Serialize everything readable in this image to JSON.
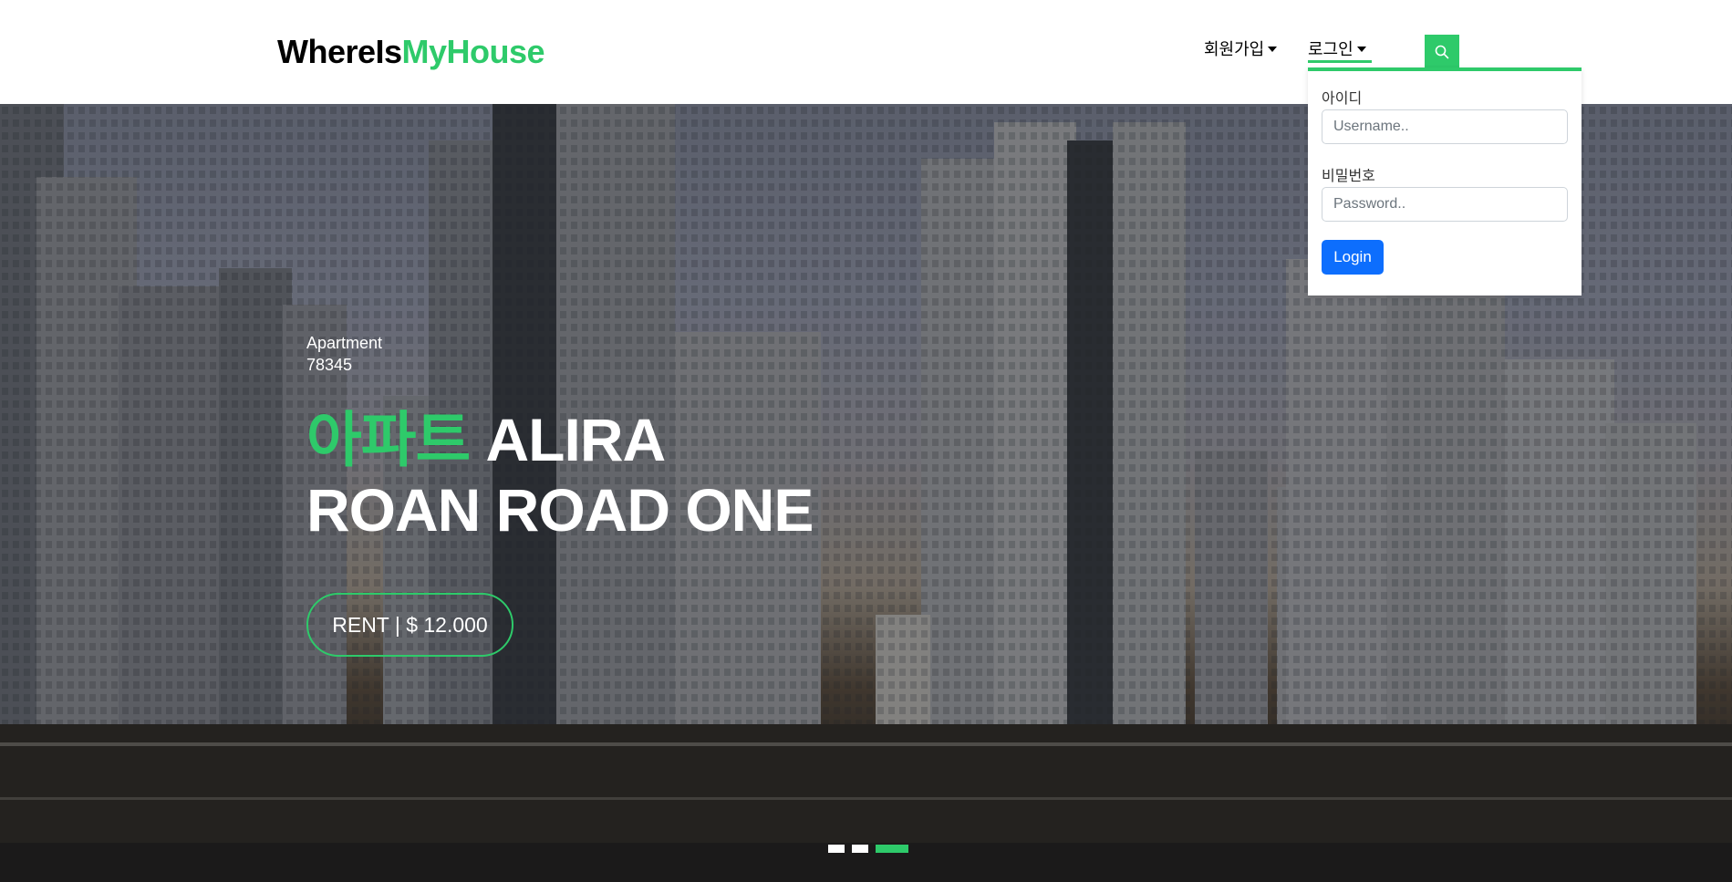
{
  "brand": {
    "name_part1": "WhereIs",
    "name_part2": "MyHouse",
    "accent_color": "#2eca6a"
  },
  "nav": {
    "signup_label": "회원가입",
    "login_label": "로그인",
    "search_icon": "search-icon"
  },
  "login_dropdown": {
    "id_label": "아이디",
    "id_placeholder": "Username..",
    "password_label": "비밀번호",
    "password_placeholder": "Password..",
    "submit_label": "Login",
    "button_color": "#0d6efd"
  },
  "hero": {
    "type_label": "Apartment",
    "code": "78345",
    "title_accent": "아파트",
    "title_line1": "ALIRA",
    "title_line2": "ROAN ROAD ONE",
    "price_label": "RENT | $ 12.000"
  },
  "carousel": {
    "active_index": 2,
    "slides": 3
  }
}
